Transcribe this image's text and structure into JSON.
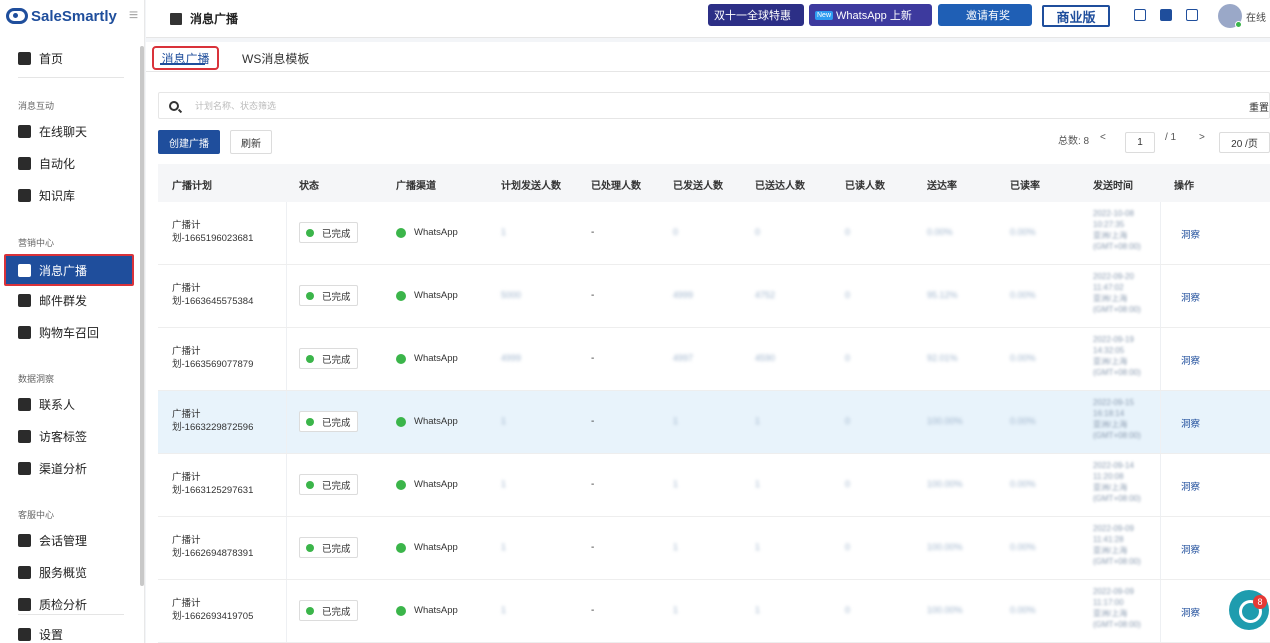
{
  "app": {
    "logo": "SaleSmartly",
    "colors": {
      "brand": "#1f4e9c",
      "success": "#3bb54a",
      "danger": "#d9323a"
    }
  },
  "sidebar": {
    "home": "首页",
    "sections": [
      "消息互动",
      "营销中心",
      "数据洞察",
      "客服中心"
    ],
    "items": [
      "在线聊天",
      "自动化",
      "知识库",
      "消息广播",
      "邮件群发",
      "购物车召回",
      "联系人",
      "访客标签",
      "渠道分析",
      "会话管理",
      "服务概览",
      "质检分析",
      "设置"
    ]
  },
  "topbar": {
    "title": "消息广播",
    "promo1": "双十一全球特惠",
    "promo2_tag": "New",
    "promo2": "WhatsApp 上新",
    "promo3": "邀请有奖",
    "business": "商业版",
    "online": "在线"
  },
  "tabs": [
    "消息广播",
    "WS消息模板"
  ],
  "toolbar": {
    "search_placeholder": "计划名称、状态筛选",
    "reset": "重置",
    "create": "创建广播",
    "refresh": "刷新",
    "total": "总数: 8",
    "page": "1",
    "pages": "/ 1",
    "per_page": "20 /页"
  },
  "table": {
    "columns": [
      "广播计划",
      "状态",
      "广播渠道",
      "计划发送人数",
      "已处理人数",
      "已发送人数",
      "已送达人数",
      "已读人数",
      "送达率",
      "已读率",
      "发送时间",
      "操作"
    ],
    "rows": [
      {
        "plan1": "广播计",
        "plan2": "划-1665196023681",
        "status": "已完成",
        "channel": "WhatsApp",
        "planned": "1",
        "processed": "-",
        "sent": "0",
        "delivered": "0",
        "read": "0",
        "rate": "0.00%",
        "readrate": "0.00%",
        "time": [
          "2022-10-08",
          "10:27:35",
          "亚洲/上海",
          "(GMT+08:00)"
        ],
        "op": "洞察"
      },
      {
        "plan1": "广播计",
        "plan2": "划-1663645575384",
        "status": "已完成",
        "channel": "WhatsApp",
        "planned": "5000",
        "processed": "-",
        "sent": "4999",
        "delivered": "4752",
        "read": "0",
        "rate": "95.12%",
        "readrate": "0.00%",
        "time": [
          "2022-09-20",
          "11:47:02",
          "亚洲/上海",
          "(GMT+08:00)"
        ],
        "op": "洞察"
      },
      {
        "plan1": "广播计",
        "plan2": "划-1663569077879",
        "status": "已完成",
        "channel": "WhatsApp",
        "planned": "4999",
        "processed": "-",
        "sent": "4997",
        "delivered": "4590",
        "read": "0",
        "rate": "92.01%",
        "readrate": "0.00%",
        "time": [
          "2022-09-19",
          "14:32:05",
          "亚洲/上海",
          "(GMT+08:00)"
        ],
        "op": "洞察"
      },
      {
        "plan1": "广播计",
        "plan2": "划-1663229872596",
        "status": "已完成",
        "channel": "WhatsApp",
        "planned": "1",
        "processed": "-",
        "sent": "1",
        "delivered": "1",
        "read": "0",
        "rate": "100.00%",
        "readrate": "0.00%",
        "time": [
          "2022-09-15",
          "16:18:14",
          "亚洲/上海",
          "(GMT+08:00)"
        ],
        "op": "洞察"
      },
      {
        "plan1": "广播计",
        "plan2": "划-1663125297631",
        "status": "已完成",
        "channel": "WhatsApp",
        "planned": "1",
        "processed": "-",
        "sent": "1",
        "delivered": "1",
        "read": "0",
        "rate": "100.00%",
        "readrate": "0.00%",
        "time": [
          "2022-09-14",
          "11:20:08",
          "亚洲/上海",
          "(GMT+08:00)"
        ],
        "op": "洞察"
      },
      {
        "plan1": "广播计",
        "plan2": "划-1662694878391",
        "status": "已完成",
        "channel": "WhatsApp",
        "planned": "1",
        "processed": "-",
        "sent": "1",
        "delivered": "1",
        "read": "0",
        "rate": "100.00%",
        "readrate": "0.00%",
        "time": [
          "2022-09-09",
          "11:41:28",
          "亚洲/上海",
          "(GMT+08:00)"
        ],
        "op": "洞察"
      },
      {
        "plan1": "广播计",
        "plan2": "划-1662693419705",
        "status": "已完成",
        "channel": "WhatsApp",
        "planned": "1",
        "processed": "-",
        "sent": "1",
        "delivered": "1",
        "read": "0",
        "rate": "100.00%",
        "readrate": "0.00%",
        "time": [
          "2022-09-09",
          "11:17:00",
          "亚洲/上海",
          "(GMT+08:00)"
        ],
        "op": "洞察"
      }
    ]
  },
  "chat": {
    "badge": "8"
  }
}
